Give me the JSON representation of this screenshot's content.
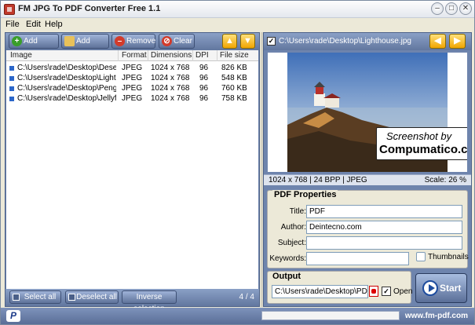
{
  "window": {
    "title": "FM JPG To PDF Converter Free 1.1"
  },
  "menu": [
    "File",
    "Edit",
    "Help"
  ],
  "toolbar": {
    "add_image": "Add image",
    "add_folder": "Add folder",
    "remove": "Remove",
    "clear": "Clear"
  },
  "list": {
    "columns": [
      "Image",
      "Format",
      "Dimensions",
      "DPI",
      "File size"
    ],
    "rows": [
      {
        "image": "C:\\Users\\rade\\Desktop\\Desert.j...",
        "format": "JPEG",
        "dimensions": "1024 x 768",
        "dpi": "96",
        "size": "826 KB"
      },
      {
        "image": "C:\\Users\\rade\\Desktop\\Lightho...",
        "format": "JPEG",
        "dimensions": "1024 x 768",
        "dpi": "96",
        "size": "548 KB"
      },
      {
        "image": "C:\\Users\\rade\\Desktop\\Pengui...",
        "format": "JPEG",
        "dimensions": "1024 x 768",
        "dpi": "96",
        "size": "760 KB"
      },
      {
        "image": "C:\\Users\\rade\\Desktop\\Jellyfish...",
        "format": "JPEG",
        "dimensions": "1024 x 768",
        "dpi": "96",
        "size": "758 KB"
      }
    ]
  },
  "bottom": {
    "select_all": "Select all",
    "deselect_all": "Deselect all",
    "inverse": "Inverse selection",
    "count": "4 / 4"
  },
  "preview": {
    "path": "C:\\Users\\rade\\Desktop\\Lighthouse.jpg",
    "info": "1024 x 768  |  24 BPP  |  JPEG",
    "scale": "Scale: 26 %",
    "watermark_line1": "Screenshot by",
    "watermark_line2": "Compumatico.com"
  },
  "pdf_properties": {
    "title_label": "PDF Properties",
    "fields": {
      "title": {
        "label": "Title:",
        "value": "PDF"
      },
      "author": {
        "label": "Author:",
        "value": "Deintecno.com"
      },
      "subject": {
        "label": "Subject:",
        "value": ""
      },
      "keywords": {
        "label": "Keywords:",
        "value": ""
      }
    },
    "thumbnails_label": "Thumbnails",
    "thumbnails_checked": false
  },
  "output": {
    "label": "Output",
    "path": "C:\\Users\\rade\\Desktop\\PDF.p",
    "open_label": "Open",
    "open_checked": true
  },
  "start_label": "Start",
  "status": {
    "paypal": "P",
    "website": "www.fm-pdf.com"
  },
  "colors": {
    "toolbar": "#6e84ad",
    "accent_arrow": "#f0a500",
    "add_green": "#3a9e2a",
    "remove_red": "#d23b2b"
  }
}
